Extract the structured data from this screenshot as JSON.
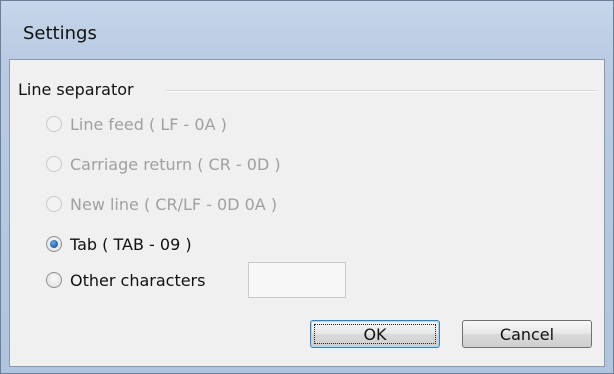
{
  "window": {
    "title": "Settings"
  },
  "group": {
    "title": "Line separator"
  },
  "options": [
    {
      "label": "Line feed ( LF - 0A )",
      "enabled": false,
      "selected": false
    },
    {
      "label": "Carriage return ( CR - 0D )",
      "enabled": false,
      "selected": false
    },
    {
      "label": "New line ( CR/LF - 0D 0A )",
      "enabled": false,
      "selected": false
    },
    {
      "label": "Tab ( TAB - 09 )",
      "enabled": true,
      "selected": true
    },
    {
      "label": "Other characters",
      "enabled": true,
      "selected": false
    }
  ],
  "other_input": {
    "value": ""
  },
  "buttons": {
    "ok": "OK",
    "cancel": "Cancel"
  }
}
